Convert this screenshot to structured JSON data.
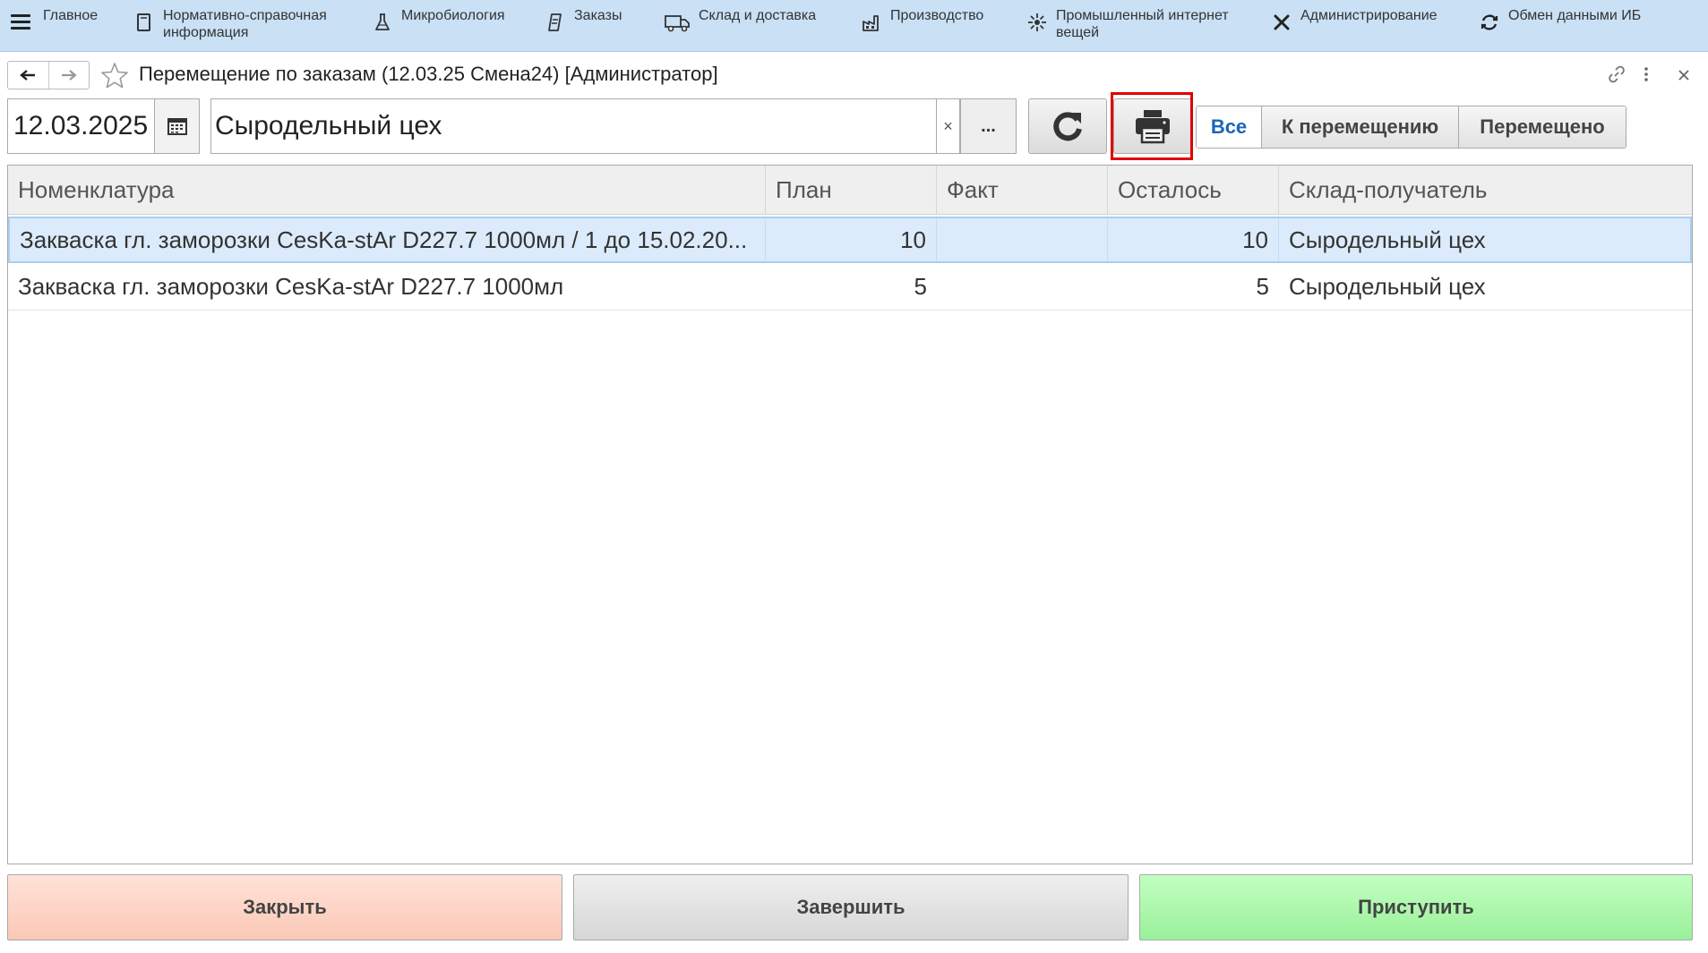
{
  "nav": {
    "items": [
      {
        "label": "Главное",
        "icon": "menu-icon"
      },
      {
        "label": "Нормативно-справочная\nинформация",
        "icon": "book-icon"
      },
      {
        "label": "Микробиология",
        "icon": "flask-icon"
      },
      {
        "label": "Заказы",
        "icon": "orders-icon"
      },
      {
        "label": "Склад и доставка",
        "icon": "truck-icon"
      },
      {
        "label": "Производство",
        "icon": "factory-icon"
      },
      {
        "label": "Промышленный интернет\nвещей",
        "icon": "iot-icon"
      },
      {
        "label": "Администрирование",
        "icon": "tools-icon"
      },
      {
        "label": "Обмен данными ИБ",
        "icon": "sync-icon"
      }
    ]
  },
  "form": {
    "title": "Перемещение по заказам (12.03.25 Смена24) [Администратор]"
  },
  "filters": {
    "date": "12.03.2025",
    "warehouse": "Сыродельный цех",
    "clear_symbol": "×",
    "more_label": "..."
  },
  "segments": [
    {
      "label": "Все",
      "active": true
    },
    {
      "label": "К перемещению",
      "active": false
    },
    {
      "label": "Перемещено",
      "active": false
    }
  ],
  "table": {
    "columns": [
      "Номенклатура",
      "План",
      "Факт",
      "Осталось",
      "Склад-получатель"
    ],
    "rows": [
      {
        "name": "Закваска гл. заморозки CesKa-stAr D227.7 1000мл / 1 до 15.02.20...",
        "plan": "10",
        "fact": "",
        "left": "10",
        "warehouse": "Сыродельный цех",
        "selected": true
      },
      {
        "name": "Закваска гл. заморозки CesKa-stAr D227.7 1000мл",
        "plan": "5",
        "fact": "",
        "left": "5",
        "warehouse": "Сыродельный цех",
        "selected": false
      }
    ]
  },
  "actions": {
    "close": "Закрыть",
    "finish": "Завершить",
    "start": "Приступить"
  },
  "colors": {
    "topbar": "#c9e0f5",
    "selected_row": "#dcebfb",
    "active_segment_text": "#1a66b8",
    "close_button": "#fbc8b6",
    "start_button": "#9af09a",
    "highlight": "#e00000"
  }
}
